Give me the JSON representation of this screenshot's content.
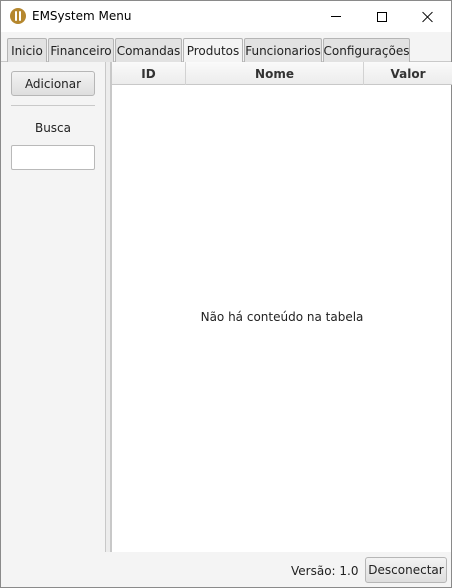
{
  "window": {
    "title": "EMSystem Menu",
    "icon": "fork-knife-icon"
  },
  "tabs": [
    {
      "label": "Inicio",
      "active": false
    },
    {
      "label": "Financeiro",
      "active": false
    },
    {
      "label": "Comandas",
      "active": false
    },
    {
      "label": "Produtos",
      "active": true
    },
    {
      "label": "Funcionarios",
      "active": false
    },
    {
      "label": "Configurações",
      "active": false
    }
  ],
  "sidebar": {
    "add_label": "Adicionar",
    "search_label": "Busca",
    "search_value": ""
  },
  "table": {
    "columns": [
      "ID",
      "Nome",
      "Valor"
    ],
    "rows": [],
    "empty_message": "Não há conteúdo na tabela"
  },
  "footer": {
    "version": "Versão: 1.0",
    "disconnect_label": "Desconectar"
  },
  "colors": {
    "accent_icon": "#b5872e"
  }
}
